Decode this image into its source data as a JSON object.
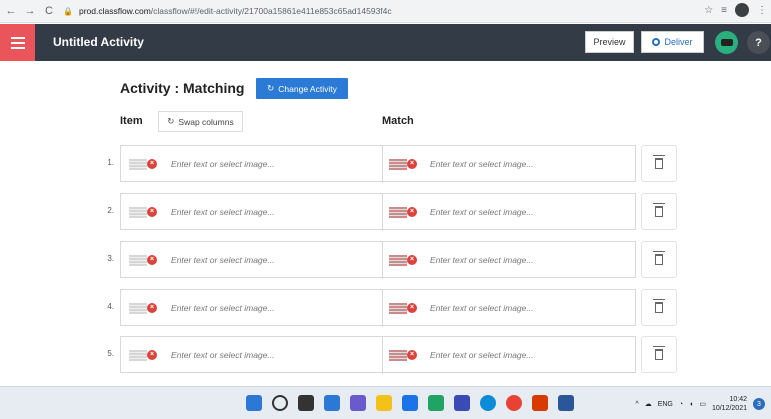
{
  "browser": {
    "back": "←",
    "forward": "→",
    "reload": "C",
    "url_host": "prod.classflow.com",
    "url_path": "/classflow/#!/edit-activity/21700a15861e411e853c65ad14593f4c"
  },
  "header": {
    "title": "Untitled Activity",
    "preview_label": "Preview",
    "deliver_label": "Deliver",
    "help_label": "?"
  },
  "activity": {
    "title": "Activity : Matching",
    "change_label": "Change Activity",
    "item_header": "Item",
    "swap_label": "Swap columns",
    "match_header": "Match"
  },
  "rows": [
    {
      "num": "1.",
      "item_placeholder": "Enter text or select image...",
      "match_placeholder": "Enter text or select image..."
    },
    {
      "num": "2.",
      "item_placeholder": "Enter text or select image...",
      "match_placeholder": "Enter text or select image..."
    },
    {
      "num": "3.",
      "item_placeholder": "Enter text or select image...",
      "match_placeholder": "Enter text or select image..."
    },
    {
      "num": "4.",
      "item_placeholder": "Enter text or select image...",
      "match_placeholder": "Enter text or select image..."
    },
    {
      "num": "5.",
      "item_placeholder": "Enter text or select image...",
      "match_placeholder": "Enter text or select image..."
    }
  ],
  "taskbar": {
    "lang": "ENG",
    "time": "10:42",
    "date": "10/12/2021",
    "notif_count": "3"
  },
  "colors": {
    "header_bg": "#333b47",
    "menu_red": "#e9555a",
    "accent_blue": "#2a7ad6",
    "delete_red": "#d9443b"
  }
}
